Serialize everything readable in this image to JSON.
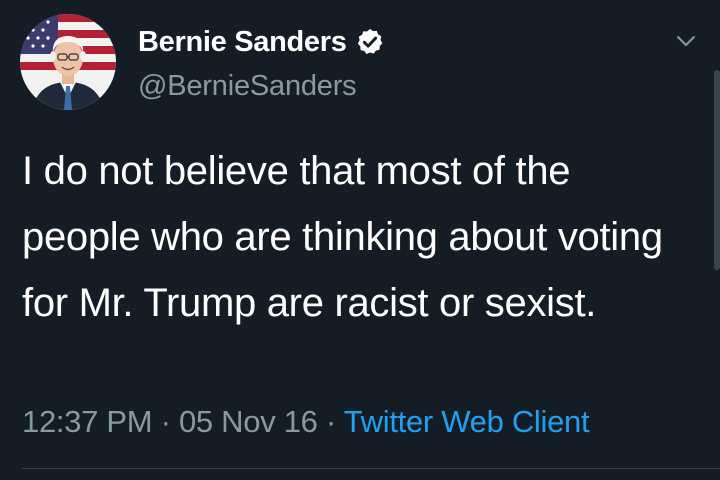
{
  "tweet": {
    "display_name": "Bernie Sanders",
    "handle": "@BernieSanders",
    "verified": true,
    "text": "I do not believe that most of the people who are thinking about voting for Mr. Trump are racist or sexist.",
    "time": "12:37 PM",
    "date": "05 Nov 16",
    "separator": "·",
    "source": "Twitter Web Client"
  },
  "icons": {
    "verified": "verified-badge-icon",
    "menu": "chevron-down-icon",
    "avatar": "avatar"
  },
  "colors": {
    "background": "#141d26",
    "text": "#ffffff",
    "secondary_text": "#8899a6",
    "link": "#1da1f2",
    "divider": "#38444d"
  }
}
